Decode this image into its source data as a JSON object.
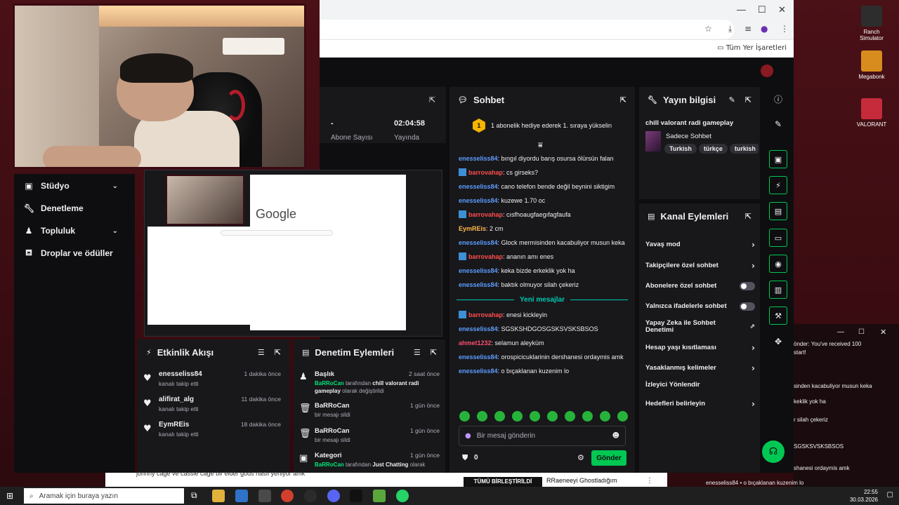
{
  "browser": {
    "bookmarks_label": "Tüm Yer İşaretleri"
  },
  "sidebar": {
    "items": [
      {
        "label": "Stüdyo",
        "icon": "studio-icon",
        "has_chevron": true
      },
      {
        "label": "Denetleme",
        "icon": "wrench-icon",
        "has_chevron": false
      },
      {
        "label": "Topluluk",
        "icon": "community-icon",
        "has_chevron": true
      },
      {
        "label": "Droplar ve ödüller",
        "icon": "gift-icon",
        "has_chevron": false
      }
    ]
  },
  "preview": {
    "google_text": "Google"
  },
  "stats": {
    "subs_value": "-",
    "subs_label": "Abone Sayısı",
    "uptime_value": "02:04:58",
    "uptime_label": "Yayında"
  },
  "chat": {
    "title": "Sohbet",
    "hype_rank": "1",
    "hype_text": "1 abonelik hediye ederek 1. sıraya yükselin",
    "messages": [
      {
        "user": "enesseliss84",
        "color": "#5e9cff",
        "badge": false,
        "text": ": bıngıl diyordu barış osursa ölürsün falan"
      },
      {
        "user": "barrovahap",
        "color": "#ff4d4d",
        "badge": true,
        "text": ": cs girseks?"
      },
      {
        "user": "enesseliss84",
        "color": "#5e9cff",
        "badge": false,
        "text": ": cano telefon bende değil beynini siktigim"
      },
      {
        "user": "enesseliss84",
        "color": "#5e9cff",
        "badge": false,
        "text": ": kuzewe 1.70 oc"
      },
      {
        "user": "barrovahap",
        "color": "#ff4d4d",
        "badge": true,
        "text": ": cısfhoaugfaegıfagfaufa"
      },
      {
        "user": "EymREis",
        "color": "#ffb84d",
        "badge": false,
        "text": ": 2 cm"
      },
      {
        "user": "enesseliss84",
        "color": "#5e9cff",
        "badge": false,
        "text": ": Glock mermisinden kacabuliyor musun keka"
      },
      {
        "user": "barrovahap",
        "color": "#ff4d4d",
        "badge": true,
        "text": ": ananın amı enes"
      },
      {
        "user": "enesseliss84",
        "color": "#5e9cff",
        "badge": false,
        "text": ": keka bizde erkeklik yok ha"
      },
      {
        "user": "enesseliss84",
        "color": "#5e9cff",
        "badge": false,
        "text": ": baktık olmuyor silah çekeriz"
      }
    ],
    "new_messages_label": "Yeni mesajlar",
    "new_messages": [
      {
        "user": "barrovahap",
        "color": "#ff4d4d",
        "badge": true,
        "text": ": enesi kickleyin"
      },
      {
        "user": "enesseliss84",
        "color": "#5e9cff",
        "badge": false,
        "text": ": SGSKSHDGOSGSKSVSKSBSOS"
      },
      {
        "user": "ahmet1232",
        "color": "#ff4d6d",
        "badge": false,
        "text": ": selamun aleyküm"
      },
      {
        "user": "enesseliss84",
        "color": "#5e9cff",
        "badge": false,
        "text": ": orospicicuklarinin dershanesi ordaymis amk"
      },
      {
        "user": "enesseliss84",
        "color": "#5e9cff",
        "badge": false,
        "text": ": o bıçaklanan kuzenim lo"
      }
    ],
    "input_placeholder": "Bir mesaj gönderin",
    "points": "0",
    "send_label": "Gönder"
  },
  "stream_info": {
    "title": "Yayın bilgisi",
    "stream_title": "chill valorant radi gameplay",
    "category": "Sadece Sohbet",
    "tags": [
      "Turkish",
      "türkçe",
      "turkish"
    ]
  },
  "actions": {
    "title": "Kanal Eylemleri",
    "items": [
      {
        "label": "Yavaş mod",
        "control": "chevron"
      },
      {
        "label": "Takipçilere özel sohbet",
        "control": "chevron"
      },
      {
        "label": "Abonelere özel sohbet",
        "control": "toggle"
      },
      {
        "label": "Yalnızca ifadelerle sohbet",
        "control": "toggle"
      },
      {
        "label": "Yapay Zeka ile Sohbet Denetimi",
        "control": "external"
      },
      {
        "label": "Hesap yaşı kısıtlaması",
        "control": "chevron"
      },
      {
        "label": "Yasaklanmış kelimeler",
        "control": "chevron"
      },
      {
        "label": "İzleyici Yönlendir",
        "control": "none"
      },
      {
        "label": "Hedefleri belirleyin",
        "control": "chevron"
      }
    ]
  },
  "feed": {
    "title": "Etkinlik Akışı",
    "items": [
      {
        "name": "enesseliss84",
        "sub": "kanalı takip etti",
        "time": "1 dakika önce"
      },
      {
        "name": "alifirat_alg",
        "sub": "kanalı takip etti",
        "time": "11 dakika önce"
      },
      {
        "name": "EymREis",
        "sub": "kanalı takip etti",
        "time": "18 dakika önce"
      }
    ]
  },
  "modlog": {
    "title": "Denetim Eylemleri",
    "items": [
      {
        "name": "Başlık",
        "actor": "BaRRoCan",
        "mid": " tarafından ",
        "target": "chill valorant radi gameplay",
        "tail": " olarak değiştirildi",
        "time": "2 saat önce"
      },
      {
        "name": "BaRRoCan",
        "actor": "",
        "mid": "bir mesajı sildi",
        "target": "",
        "tail": "",
        "time": "1 gün önce"
      },
      {
        "name": "BaRRoCan",
        "actor": "",
        "mid": "bir mesajı sildi",
        "target": "",
        "tail": "",
        "time": "1 gün önce"
      },
      {
        "name": "Kategori",
        "actor": "BaRRoCan",
        "mid": " tarafından ",
        "target": "Just Chatting",
        "tail": " olarak",
        "time": "1 gün önce"
      }
    ]
  },
  "desktop": {
    "icons": [
      {
        "label": "Ranch Simulator",
        "color": "#2d2d2d"
      },
      {
        "label": "Megabonk",
        "color": "#d98c1e"
      },
      {
        "label": "VALORANT",
        "color": "#c62b3b"
      }
    ]
  },
  "side_window": {
    "lines": [
      "önder: You've received 100",
      "start!",
      "sinden kacabuliyor musun keka",
      "keklik yok ha",
      "r silah çekeriz",
      "SGSKSVSKSBSOS",
      "shanesi ordaymis amk",
      "enesseliss84 • o bıçaklanan kuzenim lo"
    ]
  },
  "bottom_strip": {
    "left_text": "johnny cage ve cassie cage bir elder gods nasıl yeniyor amk",
    "thumb_text": "TÜMÜ BİRLEŞTİRİLDİ",
    "right_text": "RRaeneeyi Ghostladığım"
  },
  "taskbar": {
    "search_placeholder": "Aramak için buraya yazın",
    "time": "22:55",
    "date": "30.03.2026"
  }
}
